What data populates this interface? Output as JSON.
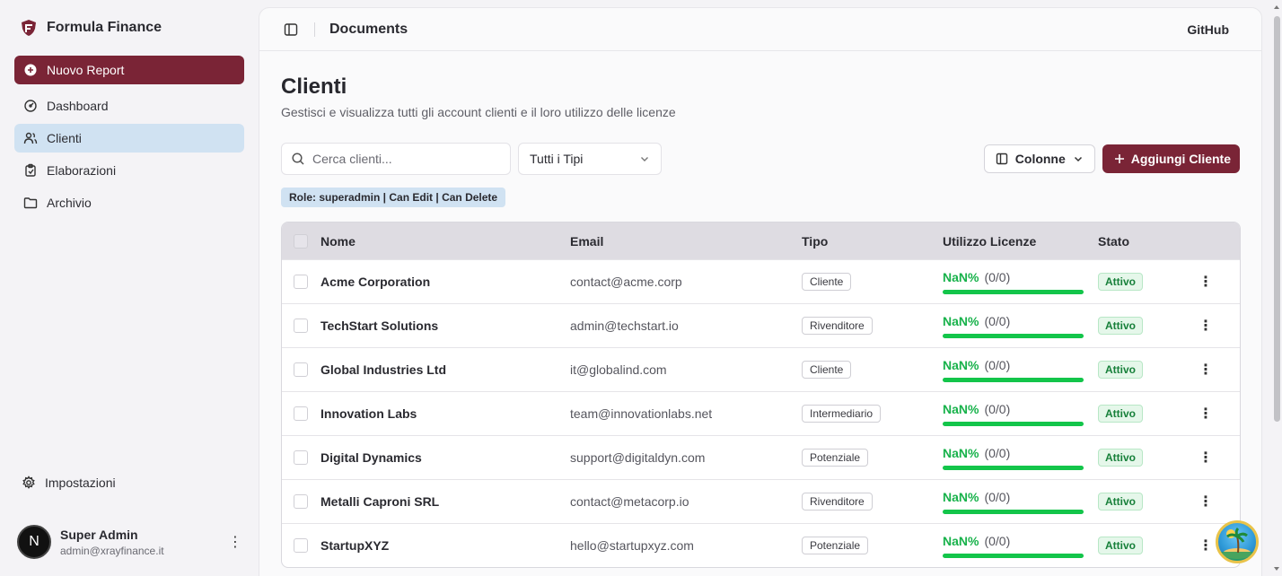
{
  "brand": {
    "name": "Formula Finance"
  },
  "sidebar": {
    "primary_button": "Nuovo Report",
    "items": [
      {
        "label": "Dashboard",
        "icon": "gauge-icon",
        "active": false
      },
      {
        "label": "Clienti",
        "icon": "users-icon",
        "active": true
      },
      {
        "label": "Elaborazioni",
        "icon": "clipboard-icon",
        "active": false
      },
      {
        "label": "Archivio",
        "icon": "folder-icon",
        "active": false
      }
    ],
    "settings_label": "Impostazioni",
    "user": {
      "initial": "N",
      "name": "Super Admin",
      "email": "admin@xrayfinance.it"
    }
  },
  "topbar": {
    "title": "Documents",
    "github_label": "GitHub"
  },
  "page": {
    "title": "Clienti",
    "subtitle": "Gestisci e visualizza tutti gli account clienti e il loro utilizzo delle licenze"
  },
  "toolbar": {
    "search_placeholder": "Cerca clienti...",
    "type_filter": "Tutti i Tipi",
    "columns_label": "Colonne",
    "add_label": "Aggiungi Cliente"
  },
  "role_badge": "Role: superadmin | Can Edit | Can Delete",
  "table": {
    "headers": {
      "name": "Nome",
      "email": "Email",
      "type": "Tipo",
      "licenses": "Utilizzo Licenze",
      "status": "Stato"
    },
    "rows": [
      {
        "name": "Acme Corporation",
        "email": "contact@acme.corp",
        "type": "Cliente",
        "pct": "NaN%",
        "count": "(0/0)",
        "status": "Attivo"
      },
      {
        "name": "TechStart Solutions",
        "email": "admin@techstart.io",
        "type": "Rivenditore",
        "pct": "NaN%",
        "count": "(0/0)",
        "status": "Attivo"
      },
      {
        "name": "Global Industries Ltd",
        "email": "it@globalind.com",
        "type": "Cliente",
        "pct": "NaN%",
        "count": "(0/0)",
        "status": "Attivo"
      },
      {
        "name": "Innovation Labs",
        "email": "team@innovationlabs.net",
        "type": "Intermediario",
        "pct": "NaN%",
        "count": "(0/0)",
        "status": "Attivo"
      },
      {
        "name": "Digital Dynamics",
        "email": "support@digitaldyn.com",
        "type": "Potenziale",
        "pct": "NaN%",
        "count": "(0/0)",
        "status": "Attivo"
      },
      {
        "name": "Metalli Caproni SRL",
        "email": "contact@metacorp.io",
        "type": "Rivenditore",
        "pct": "NaN%",
        "count": "(0/0)",
        "status": "Attivo"
      },
      {
        "name": "StartupXYZ",
        "email": "hello@startupxyz.com",
        "type": "Potenziale",
        "pct": "NaN%",
        "count": "(0/0)",
        "status": "Attivo"
      }
    ]
  },
  "colors": {
    "accent": "#7a2436",
    "active_nav": "#d0e2f2",
    "success": "#13c54a"
  }
}
